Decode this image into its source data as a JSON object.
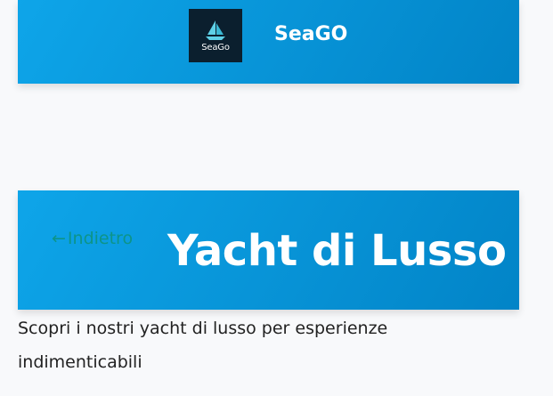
{
  "header": {
    "logo_text": "SeaGo",
    "brand_name": "SeaGO"
  },
  "hero": {
    "back_arrow": "←",
    "back_label": "Indietro",
    "title": "Yacht di Lusso",
    "description": "Scopri i nostri yacht di lusso per esperienze indimenticabili"
  },
  "icons": {
    "logo": "sailboat-icon",
    "back": "arrow-left-icon"
  },
  "colors": {
    "header_gradient_start": "#0ea5e9",
    "header_gradient_end": "#0284c7",
    "back_link": "#0d9488",
    "logo_background": "#0b1f2e",
    "page_background": "#f8f9fb"
  }
}
